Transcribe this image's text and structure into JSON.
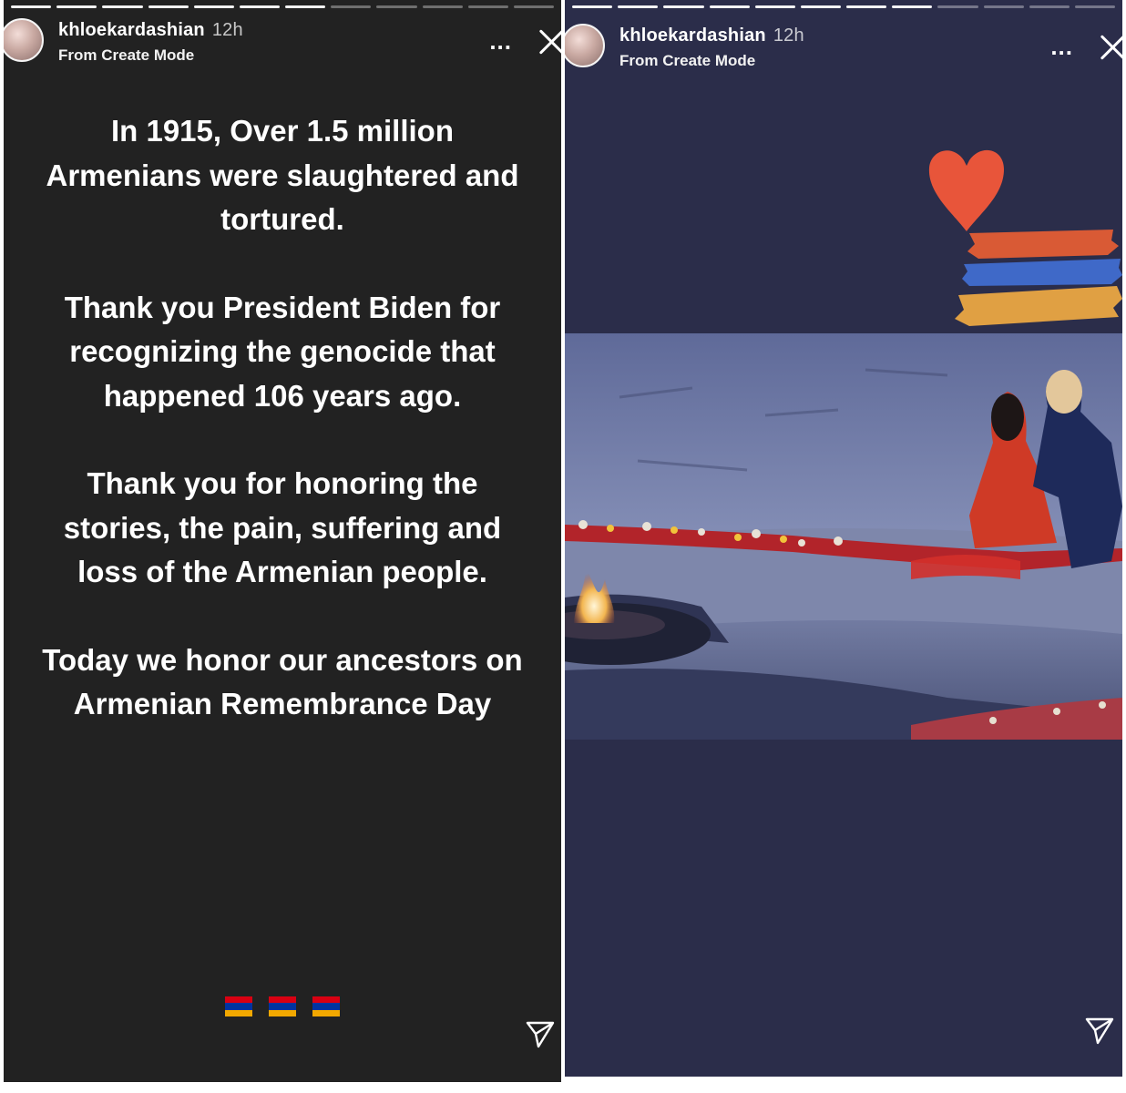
{
  "stories": [
    {
      "username": "khloekardashian",
      "time": "12h",
      "subtitle": "From Create Mode",
      "more_label": "...",
      "paragraphs": [
        "In 1915, Over 1.5 million Armenians were slaughtered and tortured.",
        "Thank you President Biden for recognizing the genocide that happened 106 years ago.",
        "Thank you for honoring the stories, the pain, suffering and loss of the Armenian people.",
        "Today we honor our ancestors on Armenian Remembrance Day"
      ],
      "flag_emojis": [
        "armenian-flag",
        "armenian-flag",
        "armenian-flag"
      ]
    },
    {
      "username": "khloekardashian",
      "time": "12h",
      "subtitle": "From Create Mode",
      "more_label": "...",
      "stickers": [
        "heart-sticker",
        "armenian-flag-brush-sticker"
      ],
      "photo": "memorial-eternal-flame-photo"
    }
  ],
  "colors": {
    "left_background": "#222222",
    "right_background": "#2b2d4a",
    "flag_red": "#d90012",
    "flag_blue": "#0033a0",
    "flag_orange": "#f2a800",
    "heart": "#e8553a"
  },
  "icons": {
    "close": "close-icon",
    "more": "more-options-icon",
    "share": "send-icon"
  }
}
